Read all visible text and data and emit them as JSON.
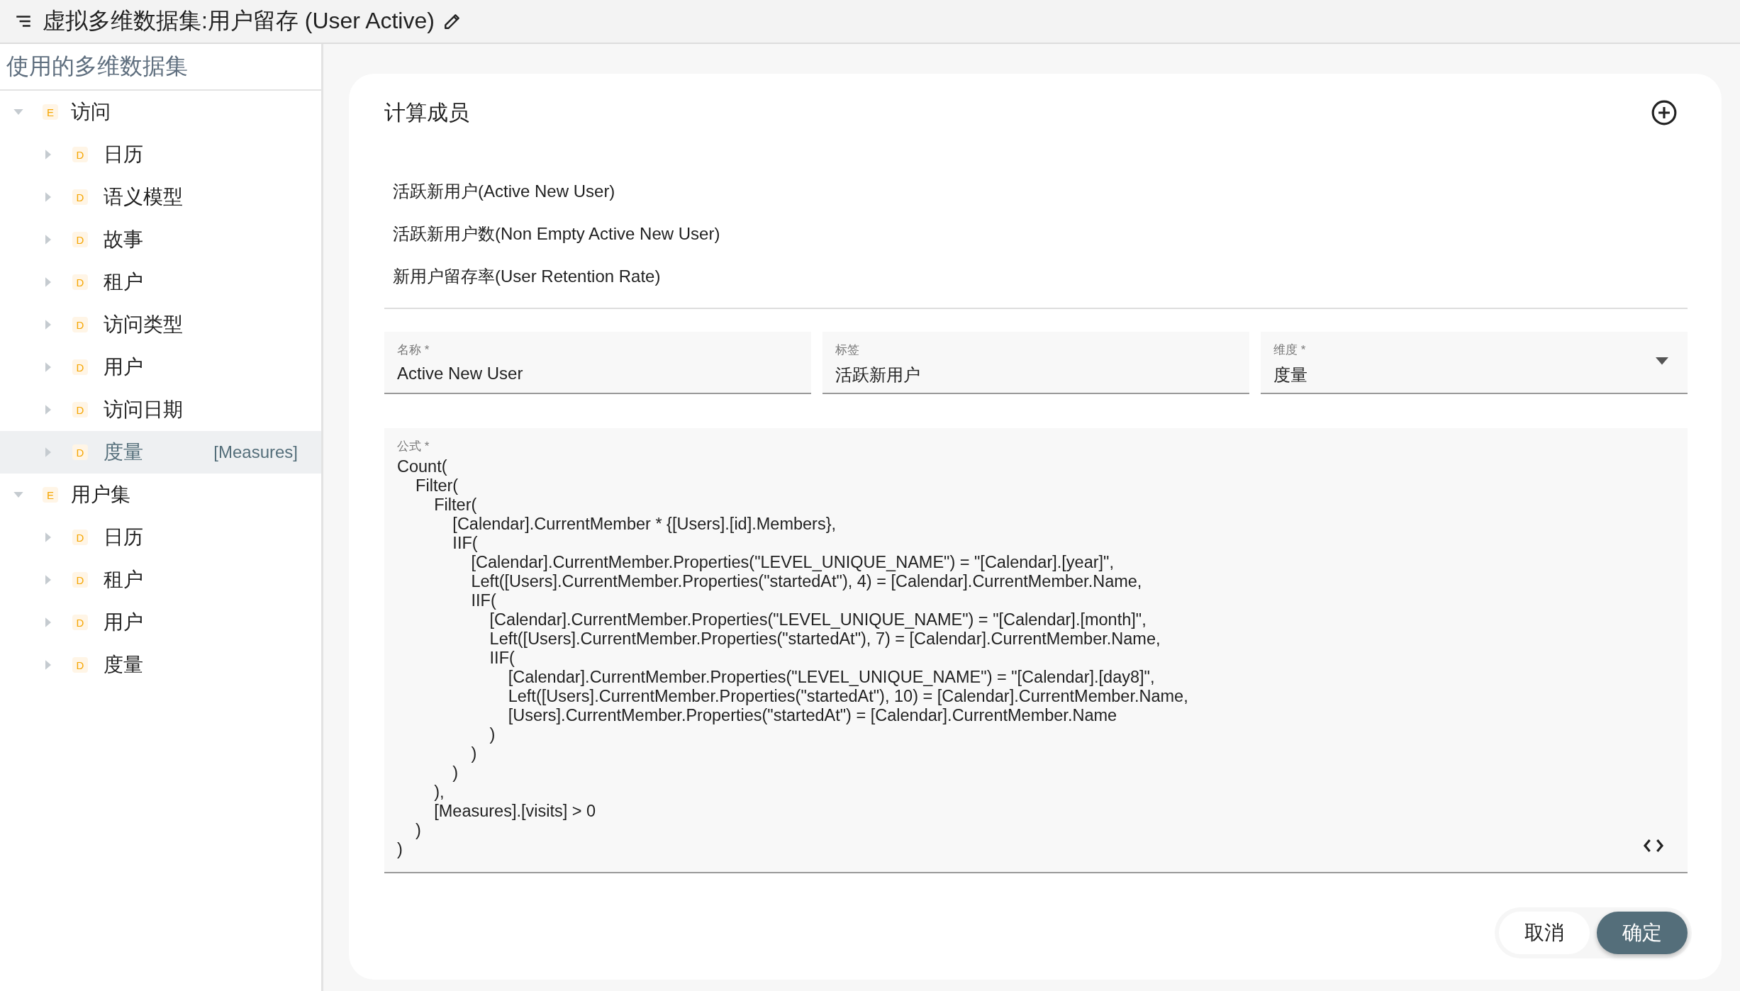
{
  "header": {
    "title": "虚拟多维数据集:用户留存 (User Active)"
  },
  "sidebar": {
    "title": "使用的多维数据集",
    "tree": [
      {
        "label": "访问",
        "badge": "E",
        "expanded": true,
        "selected": false,
        "children": [
          {
            "label": "日历",
            "badge": "D",
            "expanded": false,
            "selected": false
          },
          {
            "label": "语义模型",
            "badge": "D",
            "expanded": false,
            "selected": false
          },
          {
            "label": "故事",
            "badge": "D",
            "expanded": false,
            "selected": false
          },
          {
            "label": "租户",
            "badge": "D",
            "expanded": false,
            "selected": false
          },
          {
            "label": "访问类型",
            "badge": "D",
            "expanded": false,
            "selected": false
          },
          {
            "label": "用户",
            "badge": "D",
            "expanded": false,
            "selected": false
          },
          {
            "label": "访问日期",
            "badge": "D",
            "expanded": false,
            "selected": false
          },
          {
            "label": "度量",
            "badge": "D",
            "expanded": false,
            "selected": true,
            "suffix": "[Measures]"
          }
        ]
      },
      {
        "label": "用户集",
        "badge": "E",
        "expanded": true,
        "selected": false,
        "children": [
          {
            "label": "日历",
            "badge": "D",
            "expanded": false,
            "selected": false
          },
          {
            "label": "租户",
            "badge": "D",
            "expanded": false,
            "selected": false
          },
          {
            "label": "用户",
            "badge": "D",
            "expanded": false,
            "selected": false
          },
          {
            "label": "度量",
            "badge": "D",
            "expanded": false,
            "selected": false
          }
        ]
      }
    ]
  },
  "panel": {
    "title": "计算成员",
    "members": [
      "活跃新用户(Active New User)",
      "活跃新用户数(Non Empty Active New User)",
      "新用户留存率(User Retention Rate)"
    ],
    "fields": [
      {
        "kind": "text",
        "label": "名称 *",
        "value": "Active New User"
      },
      {
        "kind": "text",
        "label": "标签",
        "value": "活跃新用户"
      },
      {
        "kind": "select",
        "label": "维度 *",
        "value": "度量"
      }
    ],
    "formula": {
      "label": "公式 *",
      "value": "Count(\n    Filter(\n        Filter(\n            [Calendar].CurrentMember * {[Users].[id].Members},\n            IIF(\n                [Calendar].CurrentMember.Properties(\"LEVEL_UNIQUE_NAME\") = \"[Calendar].[year]\",\n                Left([Users].CurrentMember.Properties(\"startedAt\"), 4) = [Calendar].CurrentMember.Name,\n                IIF(\n                    [Calendar].CurrentMember.Properties(\"LEVEL_UNIQUE_NAME\") = \"[Calendar].[month]\",\n                    Left([Users].CurrentMember.Properties(\"startedAt\"), 7) = [Calendar].CurrentMember.Name,\n                    IIF(\n                        [Calendar].CurrentMember.Properties(\"LEVEL_UNIQUE_NAME\") = \"[Calendar].[day8]\",\n                        Left([Users].CurrentMember.Properties(\"startedAt\"), 10) = [Calendar].CurrentMember.Name,\n                        [Users].CurrentMember.Properties(\"startedAt\") = [Calendar].CurrentMember.Name\n                    )\n                )\n            )\n        ),\n        [Measures].[visits] > 0\n    )\n)"
    },
    "buttons": [
      {
        "label": "取消",
        "kind": "secondary"
      },
      {
        "label": "确定",
        "kind": "primary"
      }
    ]
  }
}
